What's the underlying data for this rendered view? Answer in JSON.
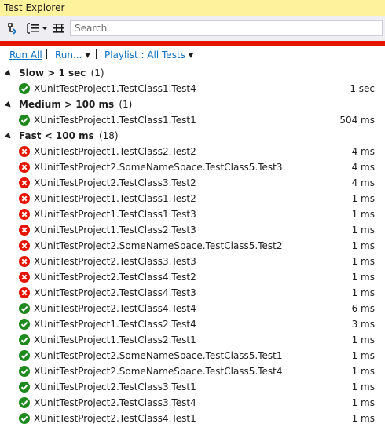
{
  "window": {
    "title": "Test Explorer"
  },
  "toolbar": {
    "search_placeholder": "Search"
  },
  "commands": {
    "run_all": "Run All",
    "run": "Run...",
    "playlist": "Playlist : All Tests"
  },
  "colors": {
    "pass": "#1e8a1e",
    "fail": "#e51400",
    "accent": "#0e70c0",
    "status_bar": "#e51400"
  },
  "groups": [
    {
      "title": "Slow > 1 sec",
      "count": "(1)",
      "tests": [
        {
          "name": "XUnitTestProject1.TestClass1.Test4",
          "duration": "1 sec",
          "status": "pass"
        }
      ]
    },
    {
      "title": "Medium > 100 ms",
      "count": "(1)",
      "tests": [
        {
          "name": "XUnitTestProject1.TestClass1.Test1",
          "duration": "504 ms",
          "status": "pass"
        }
      ]
    },
    {
      "title": "Fast < 100 ms",
      "count": "(18)",
      "tests": [
        {
          "name": "XUnitTestProject1.TestClass2.Test2",
          "duration": "4 ms",
          "status": "fail"
        },
        {
          "name": "XUnitTestProject2.SomeNameSpace.TestClass5.Test3",
          "duration": "4 ms",
          "status": "fail"
        },
        {
          "name": "XUnitTestProject2.TestClass3.Test2",
          "duration": "4 ms",
          "status": "fail"
        },
        {
          "name": "XUnitTestProject1.TestClass1.Test2",
          "duration": "1 ms",
          "status": "fail"
        },
        {
          "name": "XUnitTestProject1.TestClass1.Test3",
          "duration": "1 ms",
          "status": "fail"
        },
        {
          "name": "XUnitTestProject1.TestClass2.Test3",
          "duration": "1 ms",
          "status": "fail"
        },
        {
          "name": "XUnitTestProject2.SomeNameSpace.TestClass5.Test2",
          "duration": "1 ms",
          "status": "fail"
        },
        {
          "name": "XUnitTestProject2.TestClass3.Test3",
          "duration": "1 ms",
          "status": "fail"
        },
        {
          "name": "XUnitTestProject2.TestClass4.Test2",
          "duration": "1 ms",
          "status": "fail"
        },
        {
          "name": "XUnitTestProject2.TestClass4.Test3",
          "duration": "1 ms",
          "status": "fail"
        },
        {
          "name": "XUnitTestProject2.TestClass4.Test4",
          "duration": "6 ms",
          "status": "pass"
        },
        {
          "name": "XUnitTestProject1.TestClass2.Test4",
          "duration": "3 ms",
          "status": "pass"
        },
        {
          "name": "XUnitTestProject1.TestClass2.Test1",
          "duration": "1 ms",
          "status": "pass"
        },
        {
          "name": "XUnitTestProject2.SomeNameSpace.TestClass5.Test1",
          "duration": "1 ms",
          "status": "pass"
        },
        {
          "name": "XUnitTestProject2.SomeNameSpace.TestClass5.Test4",
          "duration": "1 ms",
          "status": "pass"
        },
        {
          "name": "XUnitTestProject2.TestClass3.Test1",
          "duration": "1 ms",
          "status": "pass"
        },
        {
          "name": "XUnitTestProject2.TestClass3.Test4",
          "duration": "1 ms",
          "status": "pass"
        },
        {
          "name": "XUnitTestProject2.TestClass4.Test1",
          "duration": "1 ms",
          "status": "pass"
        }
      ]
    }
  ]
}
